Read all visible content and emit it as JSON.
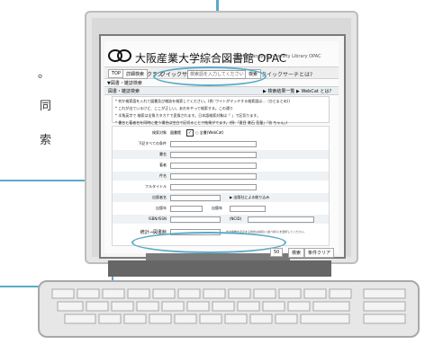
{
  "side_text": {
    "line1": "。",
    "line2": "同",
    "line3": "索"
  },
  "screen": {
    "title": "大阪産業大学綜合図書館 OPAC",
    "subtitle": "Osaka Sangyo University Library OPAC",
    "topbar": {
      "top": "TOP",
      "detail_search": "詳細検索",
      "class_label": "クラス",
      "quick_search_label": "クイックサーチ",
      "quick_search_placeholder": "検索語を入力してください",
      "search_button": "検索",
      "quick_search_help": "クイックサーチとは?"
    },
    "breadcrumb": "▼図書・雑誌検索",
    "nav": {
      "left": "図書・雑誌検索",
      "right": "▶ 検索結果一覧  ▶ WebCat とは?"
    },
    "notes": [
      "* 何か検索語を入れて図書及び雑誌を検索してください。(例: ワイトがマッチする検索語は...（ひとまとめ))",
      "* これが出ているけど、ここが正しい。あれをやって検索する。この通り",
      "* 半角英字で 検索は全角カタカナで変換されます。日本語検索対象は「 」で区切ります。",
      "* 書名と著者名を同時に使う場合は空白で区切ることで結果がでます。(例:「夏目 漱石 吾輩」「坊 ちゃん」)"
    ],
    "form": {
      "target_label": "検索対象",
      "target_option1": "図書館",
      "target_option2": "○ 全書(WebCat)",
      "fields": [
        {
          "label": "下記すべての条件",
          "alt": false
        },
        {
          "label": "書名",
          "alt": true
        },
        {
          "label": "著者",
          "alt": false
        },
        {
          "label": "件名",
          "alt": true
        },
        {
          "label": "フルタイトル",
          "alt": false
        },
        {
          "label": "出版者名",
          "alt": true
        },
        {
          "label": "出版年",
          "alt": false
        },
        {
          "label": "ISBN/ISSN",
          "alt": true
        }
      ],
      "near_publisher": "▶ 出版社による絞り込み",
      "year_range_label": "出版年",
      "ncid_label": "(NCID)",
      "sort_label": "並べ替え",
      "highlight_label": "統計→図書館",
      "bottom_note": "出力件数を表示する場合は最初に(並べ替え)を選択してください。",
      "count_value": "50",
      "search_btn": "検索",
      "clear_btn": "条件クリア"
    }
  }
}
